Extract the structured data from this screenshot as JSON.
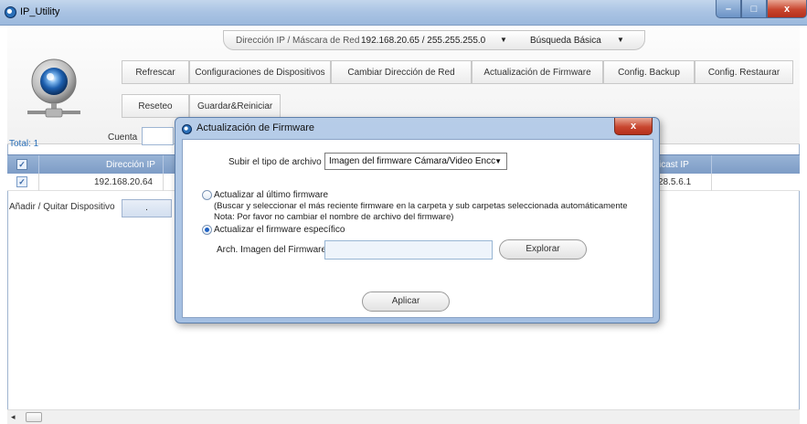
{
  "window": {
    "title": "IP_Utility",
    "minimize": "–",
    "maximize": "□",
    "close": "x"
  },
  "ip_bar": {
    "label": "Dirección IP / Máscara de Red",
    "value": "192.168.20.65 / 255.255.255.0",
    "search": "Búsqueda Básica"
  },
  "toolbar": {
    "refrescar": "Refrescar",
    "config_dispositivos": "Configuraciones de Dispositivos",
    "cambiar_red": "Cambiar Dirección de Red",
    "actualizacion_firmware": "Actualización de Firmware",
    "config_backup": "Config. Backup",
    "config_restaurar": "Config. Restaurar",
    "reseteo": "Reseteo",
    "guardar_reiniciar": "Guardar&Reiniciar"
  },
  "list": {
    "total": "Total: 1",
    "cuenta": "Cuenta",
    "columns": {
      "ip": "Dirección IP",
      "multicast": "lticast IP"
    },
    "rows": [
      {
        "ip": "192.168.20.64",
        "multicast": "28.5.6.1"
      }
    ],
    "add_remove": "Añadir / Quitar Dispositivo",
    "add_remove_value": "."
  },
  "modal": {
    "title": "Actualización de Firmware",
    "close": "x",
    "file_type_label": "Subir el tipo de archivo",
    "file_type_value": "Imagen del firmware Cámara/Video Encc",
    "option_latest": "Actualizar al último firmware",
    "option_latest_note1": "(Buscar y seleccionar el más reciente firmware en la carpeta  y sub carpetas seleccionada automáticamente",
    "option_latest_note2": "Nota: Por favor no cambiar el nombre de archivo del firmware)",
    "option_specific": "Actualizar el firmware específico",
    "file_label": "Arch. Imagen del Firmware",
    "file_value": "",
    "browse": "Explorar",
    "apply": "Aplicar"
  },
  "scroll": {
    "left_arrow": "◂"
  }
}
